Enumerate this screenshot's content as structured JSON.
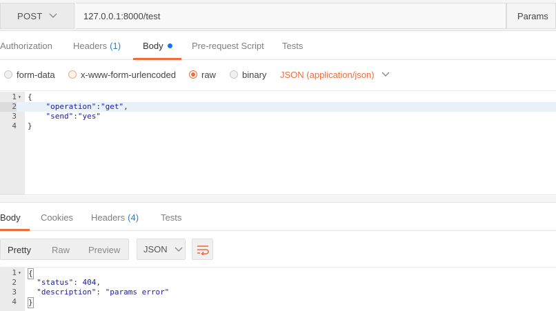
{
  "request": {
    "method": "POST",
    "url": "127.0.0.1:8000/test",
    "params_label": "Params"
  },
  "request_tabs": [
    {
      "label": "Authorization"
    },
    {
      "label": "Headers",
      "count": "(1)"
    },
    {
      "label": "Body"
    },
    {
      "label": "Pre-request Script"
    },
    {
      "label": "Tests"
    }
  ],
  "body_types": [
    {
      "label": "form-data"
    },
    {
      "label": "x-www-form-urlencoded"
    },
    {
      "label": "raw"
    },
    {
      "label": "binary"
    }
  ],
  "content_type": "JSON (application/json)",
  "request_body": {
    "line_numbers": [
      "1",
      "2",
      "3",
      "4"
    ],
    "l1": "{",
    "l2_key": "\"operation\"",
    "l2_colon": ":",
    "l2_val": "\"get\"",
    "l2_end": ",",
    "l3_key": "\"send\"",
    "l3_colon": ":",
    "l3_val": "\"yes\"",
    "l4": "}"
  },
  "response_tabs": [
    {
      "label": "Body"
    },
    {
      "label": "Cookies"
    },
    {
      "label": "Headers",
      "count": "(4)"
    },
    {
      "label": "Tests"
    }
  ],
  "view_modes": {
    "pretty": "Pretty",
    "raw": "Raw",
    "preview": "Preview"
  },
  "format": "JSON",
  "response_body": {
    "line_numbers": [
      "1",
      "2",
      "3",
      "4"
    ],
    "l1": "{",
    "l2_key": "\"status\"",
    "l2_sep": ": ",
    "l2_val": "404",
    "l2_end": ",",
    "l3_key": "\"description\"",
    "l3_sep": ": ",
    "l3_val": "\"params error\"",
    "l4": "}"
  },
  "colors": {
    "accent": "#f26b3a",
    "dot": "#1a73e8",
    "count": "#2d7fc1"
  }
}
